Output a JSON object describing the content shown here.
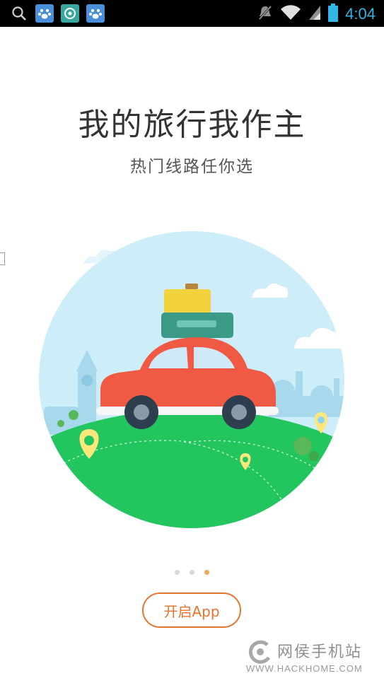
{
  "status_bar": {
    "time": "4:04",
    "icons": [
      "search-icon",
      "baidu-app-icon",
      "hd-app-icon",
      "baidu-app-icon",
      "notification-muted-icon",
      "wifi-icon",
      "signal-icon",
      "battery-icon"
    ]
  },
  "onboarding": {
    "title": "我的旅行我作主",
    "subtitle": "热门线路任你选",
    "page_indicator": {
      "total": 3,
      "current": 3
    },
    "open_button": "开启App"
  },
  "watermark": {
    "name": "网侯手机站",
    "url": "WWW.HACKHOME.COM"
  },
  "colors": {
    "accent": "#e8742e",
    "sky": "#cdeef9",
    "grass": "#22c55e",
    "car": "#f05a45",
    "status_icons": "#33b5e5"
  }
}
